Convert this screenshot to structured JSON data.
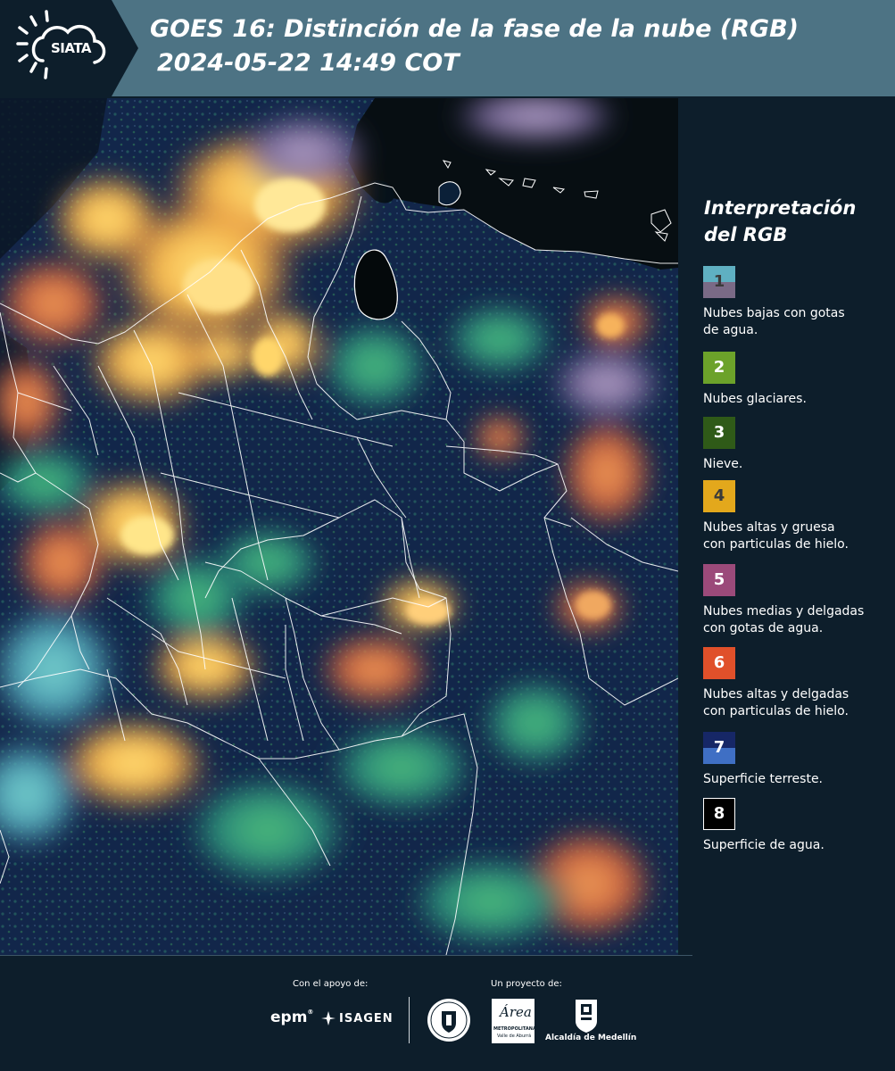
{
  "header": {
    "logo_text": "SIATA",
    "title_line1": "GOES 16: Distinción de la fase de la nube (RGB)",
    "title_line2": "2024-05-22 14:49 COT"
  },
  "legend": {
    "title": "Interpretación del RGB",
    "items": [
      {
        "number": "1",
        "label_lines": [
          "Nubes bajas con gotas",
          "de agua."
        ],
        "color_top": "#5fb0c2",
        "color_bottom": "#7a6a86",
        "text_color": "#3a3a3a"
      },
      {
        "number": "2",
        "label_lines": [
          "Nubes glaciares."
        ],
        "color_top": "#6ca22a",
        "color_bottom": "#6ca22a",
        "text_color": "#ffffff"
      },
      {
        "number": "3",
        "label_lines": [
          "Nieve."
        ],
        "color_top": "#2f5a18",
        "color_bottom": "#2f5a18",
        "text_color": "#ffffff"
      },
      {
        "number": "4",
        "label_lines": [
          "Nubes altas y gruesa",
          "con particulas de hielo."
        ],
        "color_top": "#e3a81c",
        "color_bottom": "#e3a81c",
        "text_color": "#3a3a3a"
      },
      {
        "number": "5",
        "label_lines": [
          "Nubes medias y delgadas",
          "con gotas de agua."
        ],
        "color_top": "#9b4a7a",
        "color_bottom": "#9b4a7a",
        "text_color": "#ffffff"
      },
      {
        "number": "6",
        "label_lines": [
          "Nubes altas y delgadas",
          "con particulas de hielo."
        ],
        "color_top": "#e0502a",
        "color_bottom": "#e0502a",
        "text_color": "#ffffff"
      },
      {
        "number": "7",
        "label_lines": [
          "Superficie terreste."
        ],
        "color_top": "#162766",
        "color_bottom": "#3f6fc4",
        "text_color": "#ffffff"
      },
      {
        "number": "8",
        "label_lines": [
          "Superficie de agua."
        ],
        "color_top": "#000000",
        "color_bottom": "#000000",
        "text_color": "#ffffff"
      }
    ]
  },
  "footer": {
    "support_label": "Con el apoyo de:",
    "project_label": "Un proyecto de:",
    "sponsor_logos": [
      "epm",
      "ISAGEN"
    ],
    "project_logos": [
      "Área Metropolitana Valle de Aburrá",
      "Alcaldía de Medellín"
    ],
    "epm_text": "epm",
    "isagen_text": "ISAGEN",
    "area_text": "Área",
    "area_sub1": "METROPOLITANA",
    "area_sub2": "Valle de Aburrá",
    "alcaldia_text": "Alcaldía de Medellín"
  },
  "colors": {
    "header_bg": "#4d7384",
    "logo_bg": "#0d1e2b",
    "page_bg": "#0d1e2b"
  }
}
